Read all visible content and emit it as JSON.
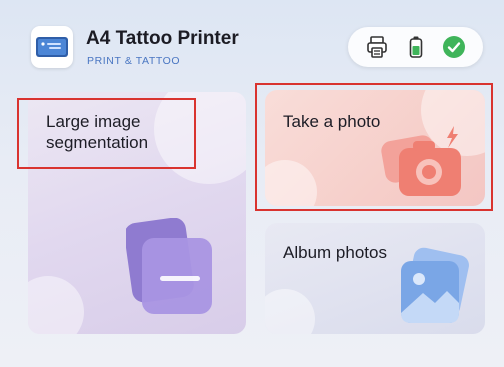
{
  "header": {
    "title": "A4 Tattoo Printer",
    "subtitle": "PRINT & TATTOO",
    "status_icons": [
      "printer-icon",
      "battery-icon",
      "connected-check-icon"
    ]
  },
  "cards": {
    "large_segmentation": {
      "label_line1": "Large image",
      "label_line2": "segmentation",
      "icon": "image-tiles-icon"
    },
    "take_photo": {
      "label": "Take a photo",
      "icon": "camera-icon"
    },
    "album": {
      "label": "Album photos",
      "icon": "gallery-icon"
    }
  },
  "colors": {
    "accent_blue": "#4a76c2",
    "success_green": "#3fb45a",
    "highlight_red": "#d9332f",
    "camera_coral": "#ef7f72",
    "segmentation_purple": "#9a84d2",
    "album_blue": "#7aa6e6"
  }
}
